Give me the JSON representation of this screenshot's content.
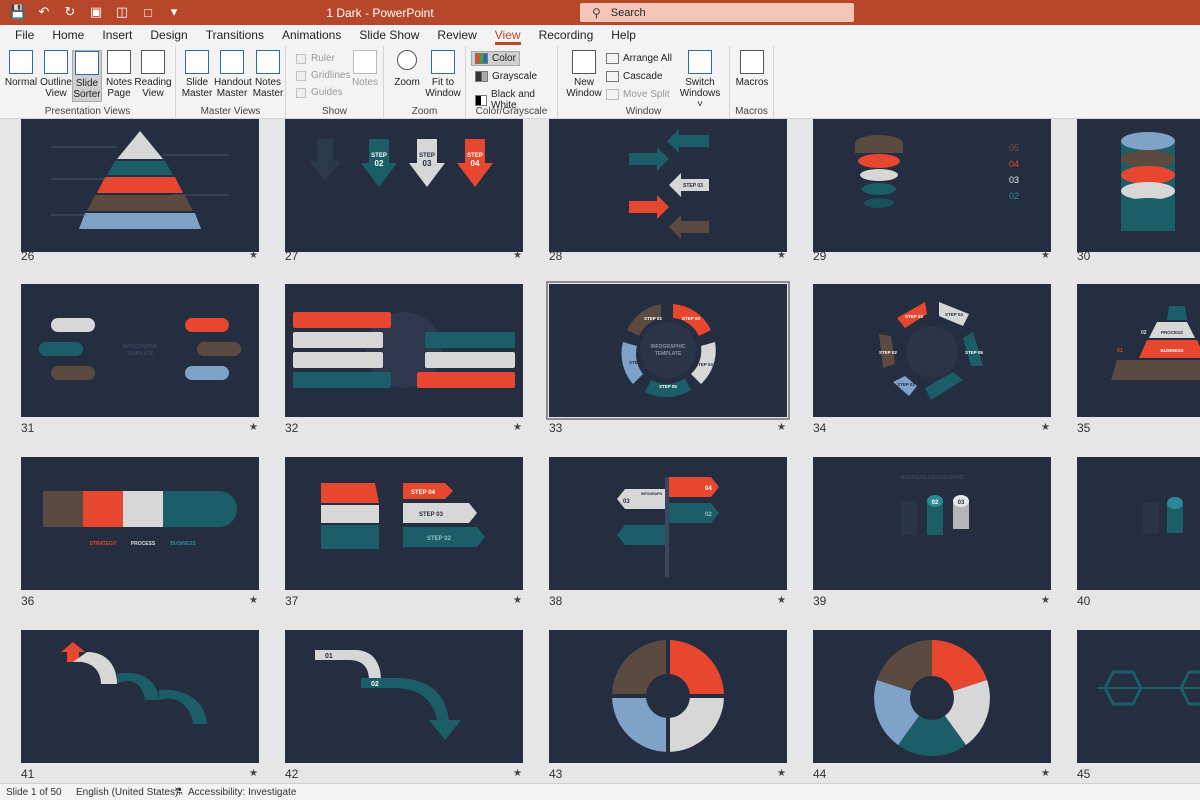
{
  "window": {
    "title": "1 Dark  -  PowerPoint"
  },
  "search": {
    "label": "Search"
  },
  "tabs": [
    "File",
    "Home",
    "Insert",
    "Design",
    "Transitions",
    "Animations",
    "Slide Show",
    "Review",
    "View",
    "Recording",
    "Help"
  ],
  "active_tab": "View",
  "ribbon": {
    "presentation_views": {
      "label": "Presentation Views",
      "normal": "Normal",
      "outline_1": "Outline",
      "outline_2": "View",
      "sorter_1": "Slide",
      "sorter_2": "Sorter",
      "notes_1": "Notes",
      "notes_2": "Page",
      "reading_1": "Reading",
      "reading_2": "View"
    },
    "master_views": {
      "label": "Master Views",
      "slide_1": "Slide",
      "slide_2": "Master",
      "handout_1": "Handout",
      "handout_2": "Master",
      "notes_1": "Notes",
      "notes_2": "Master"
    },
    "show": {
      "label": "Show",
      "ruler": "Ruler",
      "gridlines": "Gridlines",
      "guides": "Guides",
      "notes": "Notes"
    },
    "zoom": {
      "label": "Zoom",
      "zoom": "Zoom",
      "fit_1": "Fit to",
      "fit_2": "Window"
    },
    "color": {
      "label": "Color/Grayscale",
      "color": "Color",
      "grayscale": "Grayscale",
      "bw": "Black and White"
    },
    "window": {
      "label": "Window",
      "new_1": "New",
      "new_2": "Window",
      "arrange": "Arrange All",
      "cascade": "Cascade",
      "move": "Move Split",
      "switch_1": "Switch",
      "switch_2": "Windows ˅"
    },
    "macros": {
      "label": "Macros",
      "macros": "Macros"
    }
  },
  "slides": [
    {
      "num": "26"
    },
    {
      "num": "27"
    },
    {
      "num": "28"
    },
    {
      "num": "29"
    },
    {
      "num": "30"
    },
    {
      "num": "31"
    },
    {
      "num": "32"
    },
    {
      "num": "33"
    },
    {
      "num": "34"
    },
    {
      "num": "35"
    },
    {
      "num": "36"
    },
    {
      "num": "37"
    },
    {
      "num": "38"
    },
    {
      "num": "39"
    },
    {
      "num": "40"
    },
    {
      "num": "41"
    },
    {
      "num": "42"
    },
    {
      "num": "43"
    },
    {
      "num": "44"
    },
    {
      "num": "45"
    }
  ],
  "slide_text": {
    "s27": {
      "a": "STEP",
      "b": "02",
      "c": "STEP",
      "d": "03",
      "e": "STEP",
      "f": "04"
    },
    "s28": {
      "a": "STEP 03"
    },
    "s29": {
      "a": "05",
      "b": "04",
      "c": "03",
      "d": "02"
    },
    "s31": {
      "a": "INFOGRAPHIC",
      "b": "TEMPLATE"
    },
    "s33": {
      "a": "INFOGRAPHIC",
      "b": "TEMPLATE",
      "c": "STEP 02",
      "d": "STEP 03",
      "e": "STEP 04",
      "f": "STEP 05",
      "g": "STEP 01"
    },
    "s34": {
      "a": "STEP 03",
      "b": "STEP 04",
      "c": "STEP 05",
      "d": "STEP 01",
      "e": "STEP 02"
    },
    "s35": {
      "a": "PROCESS",
      "b": "BUSINESS",
      "c": "02",
      "d": "01"
    },
    "s36": {
      "a": "STRATEGY",
      "b": "PROCESS",
      "c": "BUSINESS"
    },
    "s37": {
      "a": "STEP 04",
      "b": "STEP 03",
      "c": "STEP 02"
    },
    "s38": {
      "a": "04",
      "b": "03",
      "c": "02",
      "d": "INFOGRAPH"
    },
    "s39": {
      "a": "BUSINESS INFOGRAPHIC",
      "b": "02",
      "c": "03"
    },
    "s42": {
      "a": "01",
      "b": "02"
    }
  },
  "status": {
    "slide": "Slide 1 of 50",
    "language": "English (United States)",
    "accessibility": "Accessibility: Investigate"
  },
  "colors": {
    "accent": "#b7472a",
    "slide_bg": "#252d40",
    "red": "#e8472f",
    "teal": "#1c5e68",
    "brown": "#5a4a3f",
    "gray": "#d7d7d7",
    "blue": "#7fa3c8"
  }
}
